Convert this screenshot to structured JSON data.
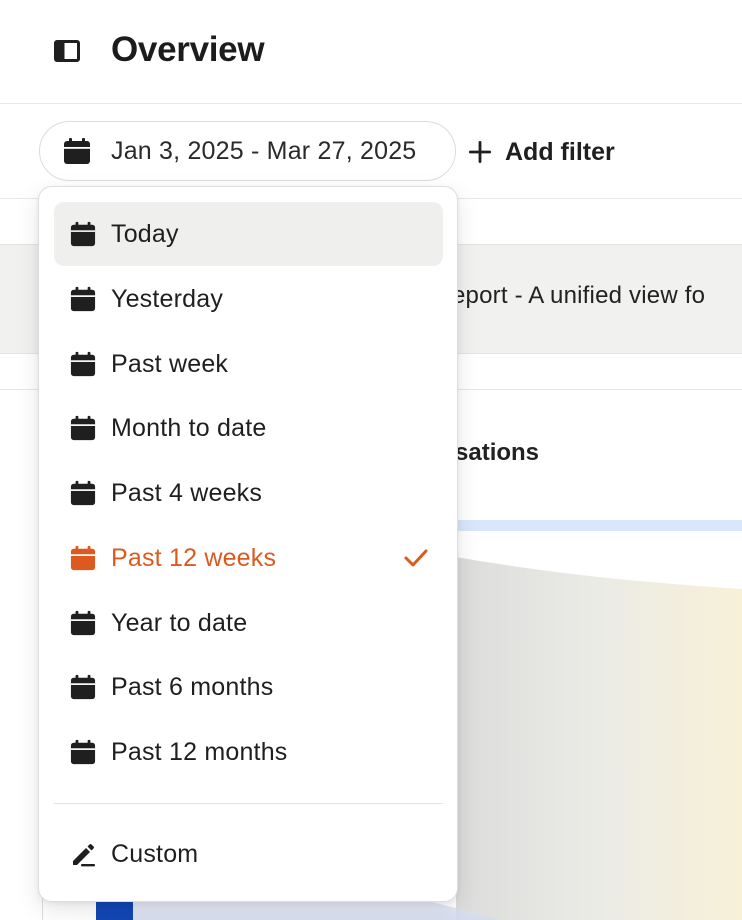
{
  "header": {
    "title": "Overview",
    "sidebar_toggle_icon": "sidebar-toggle-icon"
  },
  "filterbar": {
    "date_range": "Jan 3, 2025 - Mar 27, 2025",
    "date_icon": "calendar-icon",
    "add_filter_label": "Add filter",
    "add_filter_icon": "plus-icon"
  },
  "background": {
    "report_text": "eport - A unified view fo",
    "card_title": "sations"
  },
  "dropdown": {
    "items": [
      {
        "label": "Today",
        "icon": "calendar-icon",
        "highlighted": true,
        "selected": false
      },
      {
        "label": "Yesterday",
        "icon": "calendar-icon",
        "highlighted": false,
        "selected": false
      },
      {
        "label": "Past week",
        "icon": "calendar-icon",
        "highlighted": false,
        "selected": false
      },
      {
        "label": "Month to date",
        "icon": "calendar-icon",
        "highlighted": false,
        "selected": false
      },
      {
        "label": "Past 4 weeks",
        "icon": "calendar-icon",
        "highlighted": false,
        "selected": false
      },
      {
        "label": "Past 12 weeks",
        "icon": "calendar-icon",
        "highlighted": false,
        "selected": true
      },
      {
        "label": "Year to date",
        "icon": "calendar-icon",
        "highlighted": false,
        "selected": false
      },
      {
        "label": "Past 6 months",
        "icon": "calendar-icon",
        "highlighted": false,
        "selected": false
      },
      {
        "label": "Past 12 months",
        "icon": "calendar-icon",
        "highlighted": false,
        "selected": false
      }
    ],
    "custom": {
      "label": "Custom",
      "icon": "pencil-icon"
    },
    "selected_icon": "checkmark-icon"
  },
  "colors": {
    "accent": "#dc5a1f",
    "highlight_bg": "#efefee",
    "icon_dark": "#1f1f1f",
    "chart_blue": "#1346b4"
  }
}
